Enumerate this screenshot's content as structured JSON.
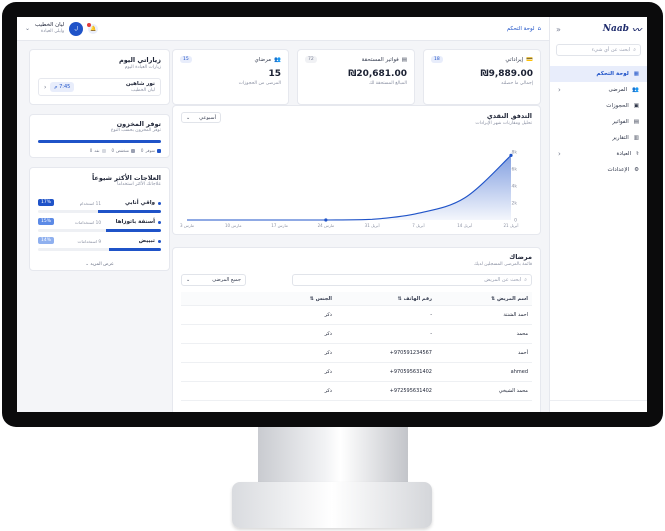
{
  "app": {
    "logo": "Naab",
    "collapse_icon": "«"
  },
  "sidebar": {
    "search_placeholder": "ابحث عن أي شيء",
    "items": [
      {
        "label": "لوحة التحكم",
        "icon": "▦",
        "active": true,
        "chevron": ""
      },
      {
        "label": "المرضى",
        "icon": "👥",
        "active": false,
        "chevron": "‹"
      },
      {
        "label": "الحجوزات",
        "icon": "▣",
        "active": false,
        "chevron": ""
      },
      {
        "label": "الفواتير",
        "icon": "▤",
        "active": false,
        "chevron": ""
      },
      {
        "label": "التقارير",
        "icon": "▥",
        "active": false,
        "chevron": ""
      },
      {
        "label": "العيادة",
        "icon": "⚕",
        "active": false,
        "chevron": "‹"
      },
      {
        "label": "الإعدادات",
        "icon": "⚙",
        "active": false,
        "chevron": ""
      }
    ]
  },
  "header": {
    "breadcrumb": "لوحة التحكم",
    "user_name": "ليان الخطيب",
    "clinic": "وايلي العيادة",
    "avatar_initial": "ل"
  },
  "stats": [
    {
      "label": "إيراداتي",
      "badge": "18",
      "value": "₪9,889.00",
      "sub": "إجمالي ما حصلته",
      "icon": "💳"
    },
    {
      "label": "فواتير المستحقة",
      "badge": "72",
      "value": "₪20,681.00",
      "sub": "المبالغ المستحقة لك",
      "icon": "▤"
    },
    {
      "label": "مرضاي",
      "badge": "15",
      "value": "15",
      "sub": "المرضى من الحجوزات",
      "icon": "👥"
    }
  ],
  "cashflow": {
    "title": "التدفق النقدي",
    "subtitle": "تحليل ومقارنات شهر الإيرادات",
    "period": "أسبوعي",
    "y_ticks": [
      "8k",
      "6k",
      "4k",
      "2k",
      "0"
    ],
    "x_ticks": [
      "مارس 3",
      "مارس 10",
      "مارس 17",
      "مارس 24",
      "أبريل 31",
      "أبريل 7",
      "أبريل 14",
      "أبريل 21"
    ]
  },
  "chart_data": {
    "type": "area",
    "title": "التدفق النقدي",
    "x": [
      "مارس 3",
      "مارس 10",
      "مارس 17",
      "مارس 24",
      "أبريل 31",
      "أبريل 7",
      "أبريل 14",
      "أبريل 21"
    ],
    "series": [
      {
        "values": [
          0,
          0,
          0,
          0,
          80,
          800,
          2600,
          7600
        ]
      }
    ],
    "ylim": [
      0,
      8000
    ],
    "grid": false,
    "color": "#1f53c8"
  },
  "patients": {
    "title": "مرضاك",
    "subtitle": "قائمة بالمرضى المسجلين لديك",
    "search_placeholder": "ابحث عن المريض",
    "filter": "جميع المرضى",
    "columns": [
      "اسم المريض",
      "رقم الهاتف",
      "الجنس"
    ],
    "rows": [
      {
        "name": "احمد الشنتة",
        "phone": "-",
        "gender": "ذكر"
      },
      {
        "name": "محمد",
        "phone": "-",
        "gender": "ذكر"
      },
      {
        "name": "أحمد",
        "phone": "+970591234567",
        "gender": "ذكر"
      },
      {
        "name": "ahmed",
        "phone": "+970595631402",
        "gender": "ذكر"
      },
      {
        "name": "محمد الشيخي",
        "phone": "+972595631402",
        "gender": "ذكر"
      }
    ]
  },
  "visits": {
    "title": "زياراتي اليوم",
    "subtitle": "زيارات العيادة اليوم",
    "item": {
      "name": "نور شاهين",
      "doctor": "ليان الخطيب",
      "time": "7:45 م"
    }
  },
  "inventory": {
    "title": "توفر المخزون",
    "subtitle": "توفر المخزون بحسب النوع",
    "fill": 1.0,
    "legend": [
      {
        "label": "متوفر",
        "color": "#1f53c8"
      },
      {
        "label": "منخفض",
        "color": "#9aa0b2"
      },
      {
        "label": "نفد",
        "color": "#d6d9e0"
      }
    ],
    "counts": [
      "0",
      "0",
      "0"
    ]
  },
  "treatments": {
    "title": "العلاجات الأكثر شيوعاً",
    "subtitle": "علاجاتك الأكثر استخداماً",
    "more": "عرض المزيد",
    "items": [
      {
        "name": "واقي أنابي",
        "count": "11 استخدام",
        "pct": "17%",
        "value": 0.17
      },
      {
        "name": "أسنفة باتوزاها",
        "count": "10 استخدامات",
        "pct": "15%",
        "value": 0.15
      },
      {
        "name": "تبييض",
        "count": "9 استخدامات",
        "pct": "14%",
        "value": 0.14
      }
    ]
  }
}
